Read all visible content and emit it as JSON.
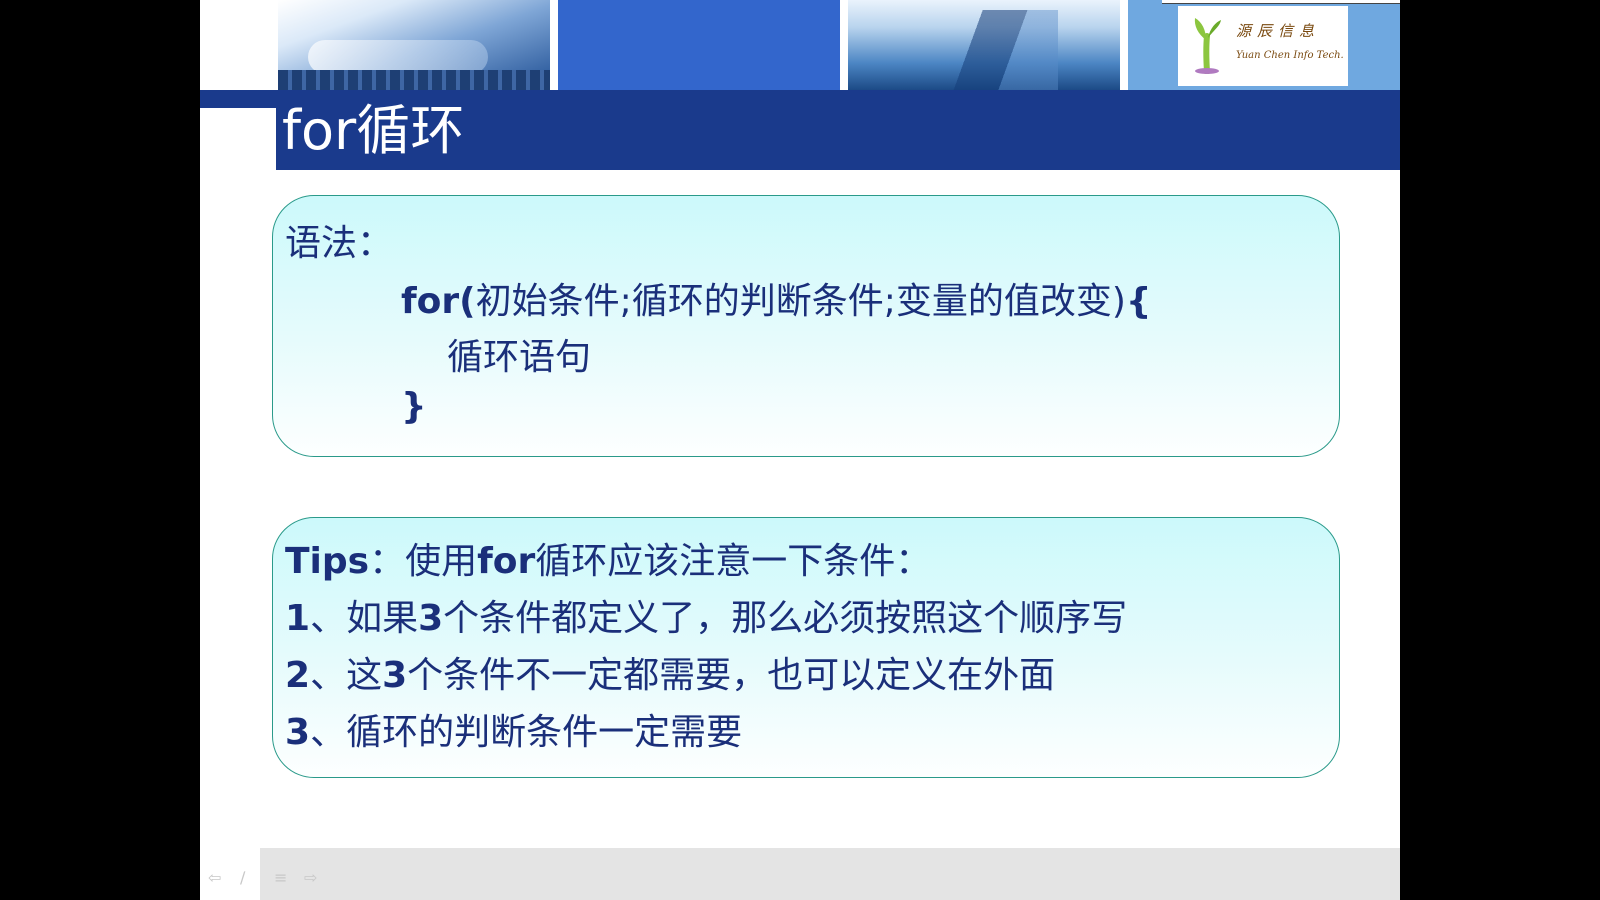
{
  "header": {
    "logo_cn": "源辰信息",
    "logo_en": "Yuan Chen Info Tech."
  },
  "slide": {
    "title": "for循环"
  },
  "syntax_box": {
    "label": "语法：",
    "line1_keyword": "for(",
    "line1_rest": "初始条件;循环的判断条件;变量的值改变)",
    "line1_brace": "{",
    "line2": "循环语句",
    "line3": "}"
  },
  "tips_box": {
    "heading_strong": "Tips",
    "heading_rest": "：使用",
    "heading_for": "for",
    "heading_tail": "循环应该注意一下条件：",
    "items": [
      {
        "num": "1",
        "text": "、如果",
        "strong": "3",
        "rest": "个条件都定义了，那么必须按照这个顺序写"
      },
      {
        "num": "2",
        "text": "、这",
        "strong": "3",
        "rest": "个条件不一定都需要，也可以定义在外面"
      },
      {
        "num": "3",
        "text": "、循环的判断条件一定需要",
        "strong": "",
        "rest": ""
      }
    ]
  },
  "toolbar": {
    "prev_icon": "arrow-left-icon",
    "pen_icon": "pen-icon",
    "menu_icon": "menu-icon",
    "next_icon": "arrow-right-icon"
  },
  "colors": {
    "title_bar": "#1a3a8c",
    "text": "#1a2f7a",
    "box_border": "#2a9a8a",
    "box_fill": "#ccf9fb"
  }
}
